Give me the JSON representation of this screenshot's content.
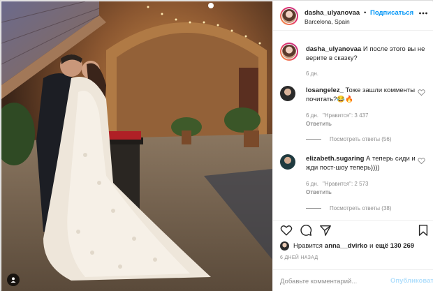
{
  "post": {
    "username": "dasha_ulyanovaa",
    "separator": "•",
    "follow_label": "Подписаться",
    "location": "Barcelona, Spain",
    "more_icon": "more-horizontal-icon"
  },
  "caption": {
    "username": "dasha_ulyanovaa",
    "text": "И после этого вы не верите в сказку?",
    "time": "6 дн."
  },
  "comments": [
    {
      "username": "losangelez_",
      "text": "Тоже зашли комменты почитать?😂🔥",
      "time": "6 дн.",
      "likes": "\"Нравится\": 3 437",
      "reply": "Ответить",
      "view_replies": "Посмотреть ответы (56)",
      "avatar_color": "#2a2a2a"
    },
    {
      "username": "elizabeth.sugaring",
      "text": "А теперь сиди и жди пост-шоу теперь))))",
      "time": "6 дн.",
      "likes": "\"Нравится\": 2 573",
      "reply": "Ответить",
      "view_replies": "Посмотреть ответы (38)",
      "avatar_color": "#1f3a3f"
    }
  ],
  "actions": {
    "icons": [
      "heart-icon",
      "comment-icon",
      "share-icon",
      "bookmark-icon"
    ],
    "likes_prefix": "Нравится",
    "likes_user": "anna__dvirko",
    "likes_and": "и",
    "likes_count": "ещё 130 269",
    "post_time": "6 ДНЕЙ НАЗАД"
  },
  "add_comment": {
    "placeholder": "Добавьте комментарий...",
    "publish_label": "Опубликовать"
  },
  "colors": {
    "accent": "#0095f6",
    "publish_disabled": "#b2dffc",
    "muted": "#8e8e8e",
    "text": "#262626"
  }
}
